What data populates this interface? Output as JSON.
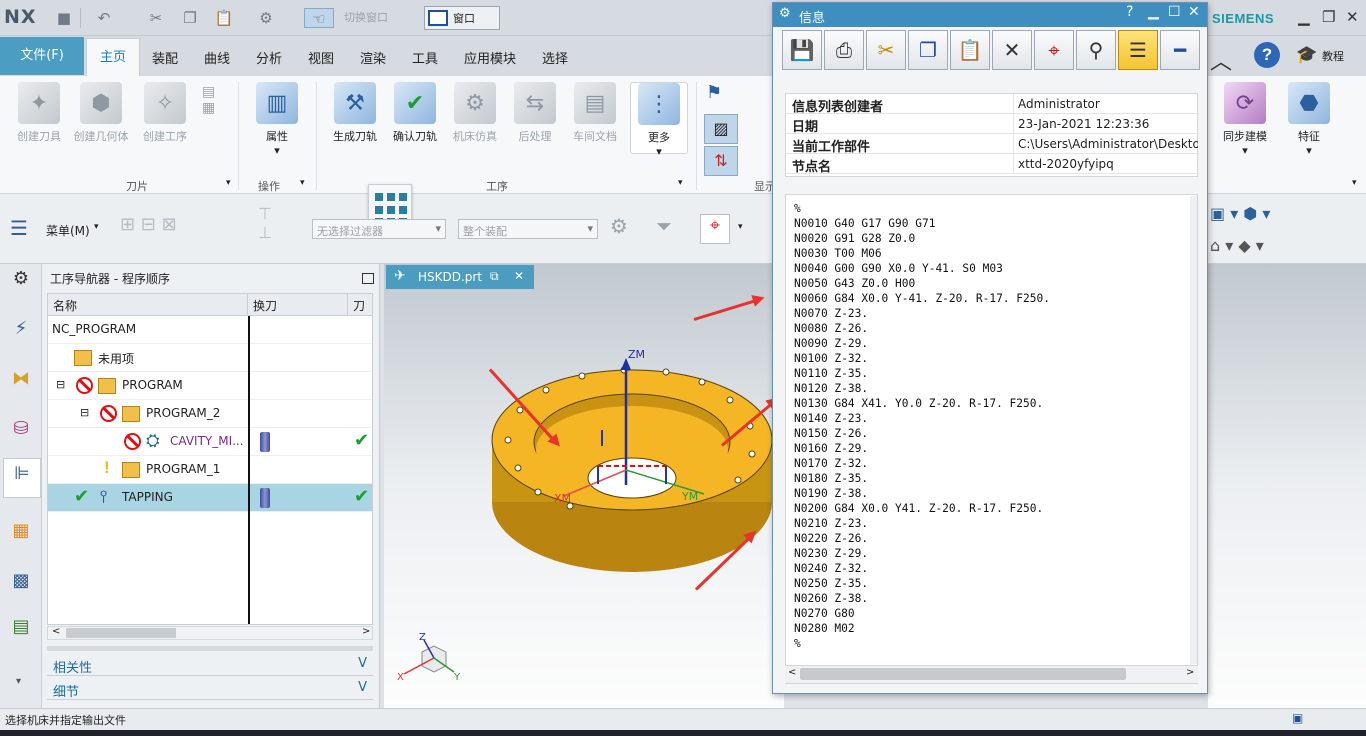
{
  "app": {
    "logo": "NX",
    "switch_window": "切换窗口",
    "window_menu": "窗口",
    "brand": "SIEMENS",
    "help_label": "教程",
    "accent": "#4b9ec1"
  },
  "tabs": [
    "文件(F)",
    "主页",
    "装配",
    "曲线",
    "分析",
    "视图",
    "渲染",
    "工具",
    "应用模块",
    "选择"
  ],
  "active_tab": "主页",
  "ribbon": {
    "buttons": [
      {
        "label": "创建刀具",
        "enabled": false
      },
      {
        "label": "创建几何体",
        "enabled": false
      },
      {
        "label": "创建工序",
        "enabled": false
      },
      {
        "label": "属性",
        "enabled": true
      },
      {
        "label": "生成刀轨",
        "enabled": true
      },
      {
        "label": "确认刀轨",
        "enabled": true
      },
      {
        "label": "机床仿真",
        "enabled": false
      },
      {
        "label": "后处理",
        "enabled": false
      },
      {
        "label": "车间文档",
        "enabled": false
      },
      {
        "label": "更多",
        "enabled": true
      }
    ],
    "groups": [
      "刀片",
      "操作",
      "工序",
      "显示"
    ],
    "right_buttons": [
      "同步建模",
      "特征"
    ]
  },
  "toolbar2": {
    "menu_label": "菜单(M)",
    "filter_placeholder": "无选择过滤器",
    "assembly_placeholder": "整个装配"
  },
  "navigator": {
    "title": "工序导航器 - 程序顺序",
    "columns": [
      "名称",
      "换刀",
      "刀轨"
    ],
    "rows": [
      {
        "name": "NC_PROGRAM",
        "indent": 0
      },
      {
        "name": "未用项",
        "indent": 1
      },
      {
        "name": "PROGRAM",
        "indent": 1
      },
      {
        "name": "PROGRAM_2",
        "indent": 2
      },
      {
        "name": "CAVITY_MI...",
        "indent": 3
      },
      {
        "name": "PROGRAM_1",
        "indent": 2
      },
      {
        "name": "TAPPING",
        "indent": 1,
        "selected": true
      }
    ],
    "panels": [
      "相关性",
      "细节"
    ]
  },
  "graphics": {
    "tab_name": "HSKDD.prt",
    "axis_labels": [
      "ZM",
      "XM",
      "YM"
    ],
    "triad_labels": [
      "Z",
      "X",
      "Y"
    ]
  },
  "dialog": {
    "title": "信息",
    "info": [
      {
        "key": "信息列表创建者",
        "value": "Administrator"
      },
      {
        "key": "日期",
        "value": "23-Jan-2021 12:23:36"
      },
      {
        "key": "当前工作部件",
        "value": "C:\\Users\\Administrator\\Desktop\\H"
      },
      {
        "key": "节点名",
        "value": "xttd-2020yfyipq"
      }
    ],
    "code": [
      "%",
      "N0010 G40 G17 G90 G71",
      "N0020 G91 G28 Z0.0",
      "N0030 T00 M06",
      "N0040 G00 G90 X0.0 Y-41. S0 M03",
      "N0050 G43 Z0.0 H00",
      "N0060 G84 X0.0 Y-41. Z-20. R-17. F250.",
      "N0070 Z-23.",
      "N0080 Z-26.",
      "N0090 Z-29.",
      "N0100 Z-32.",
      "N0110 Z-35.",
      "N0120 Z-38.",
      "N0130 G84 X41. Y0.0 Z-20. R-17. F250.",
      "N0140 Z-23.",
      "N0150 Z-26.",
      "N0160 Z-29.",
      "N0170 Z-32.",
      "N0180 Z-35.",
      "N0190 Z-38.",
      "N0200 G84 X0.0 Y41. Z-20. R-17. F250.",
      "N0210 Z-23.",
      "N0220 Z-26.",
      "N0230 Z-29.",
      "N0240 Z-32.",
      "N0250 Z-35.",
      "N0260 Z-38.",
      "N0270 G80",
      "N0280 M02",
      "%"
    ]
  },
  "status_text": "选择机床并指定输出文件"
}
